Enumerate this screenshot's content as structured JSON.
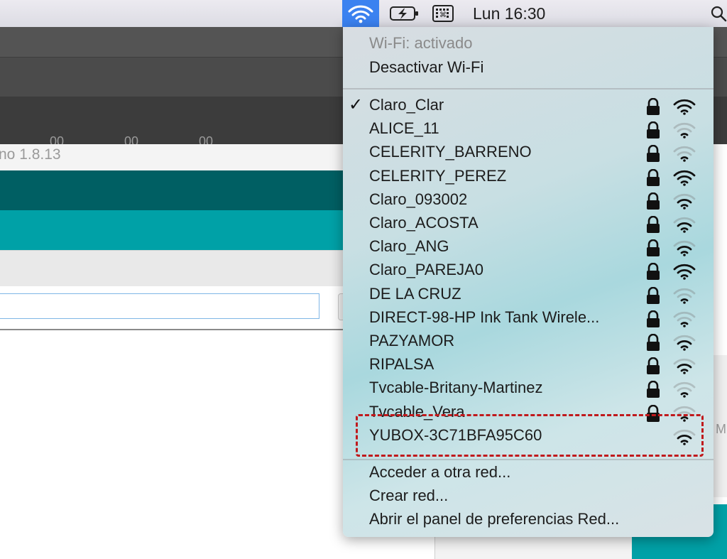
{
  "menubar": {
    "clock": "Lun 16:30",
    "icons": [
      "wifi-icon",
      "battery-icon",
      "keyboard-icon",
      "spotlight-icon"
    ]
  },
  "background_app": {
    "title": "no 1.8.13",
    "ruler_label_1": "00",
    "ruler_label_2": "00",
    "ruler_label_3": "00",
    "side_label": "M"
  },
  "wifi_menu": {
    "status": "Wi-Fi: activado",
    "toggle": "Desactivar Wi-Fi",
    "networks": [
      {
        "name": "Claro_Clar",
        "connected": true,
        "locked": true,
        "signal": 3
      },
      {
        "name": "ALICE_11",
        "connected": false,
        "locked": true,
        "signal": 1
      },
      {
        "name": "CELERITY_BARRENO",
        "connected": false,
        "locked": true,
        "signal": 1
      },
      {
        "name": "CELERITY_PEREZ",
        "connected": false,
        "locked": true,
        "signal": 3
      },
      {
        "name": "Claro_093002",
        "connected": false,
        "locked": true,
        "signal": 2
      },
      {
        "name": "Claro_ACOSTA",
        "connected": false,
        "locked": true,
        "signal": 2
      },
      {
        "name": "Claro_ANG",
        "connected": false,
        "locked": true,
        "signal": 2
      },
      {
        "name": "Claro_PAREJA0",
        "connected": false,
        "locked": true,
        "signal": 3
      },
      {
        "name": "DE LA CRUZ",
        "connected": false,
        "locked": true,
        "signal": 1
      },
      {
        "name": "DIRECT-98-HP Ink Tank Wirele...",
        "connected": false,
        "locked": true,
        "signal": 1
      },
      {
        "name": "PAZYAMOR",
        "connected": false,
        "locked": true,
        "signal": 2
      },
      {
        "name": "RIPALSA",
        "connected": false,
        "locked": true,
        "signal": 2
      },
      {
        "name": "Tvcable-Britany-Martinez",
        "connected": false,
        "locked": true,
        "signal": 1
      },
      {
        "name": "Tvcable_Vera",
        "connected": false,
        "locked": true,
        "signal": 1
      },
      {
        "name": "YUBOX-3C71BFA95C60",
        "connected": false,
        "locked": false,
        "signal": 2
      }
    ],
    "join_other": "Acceder a otra red...",
    "create_network": "Crear red...",
    "open_prefs": "Abrir el panel de preferencias Red...",
    "highlight_color": "#c0191c"
  }
}
